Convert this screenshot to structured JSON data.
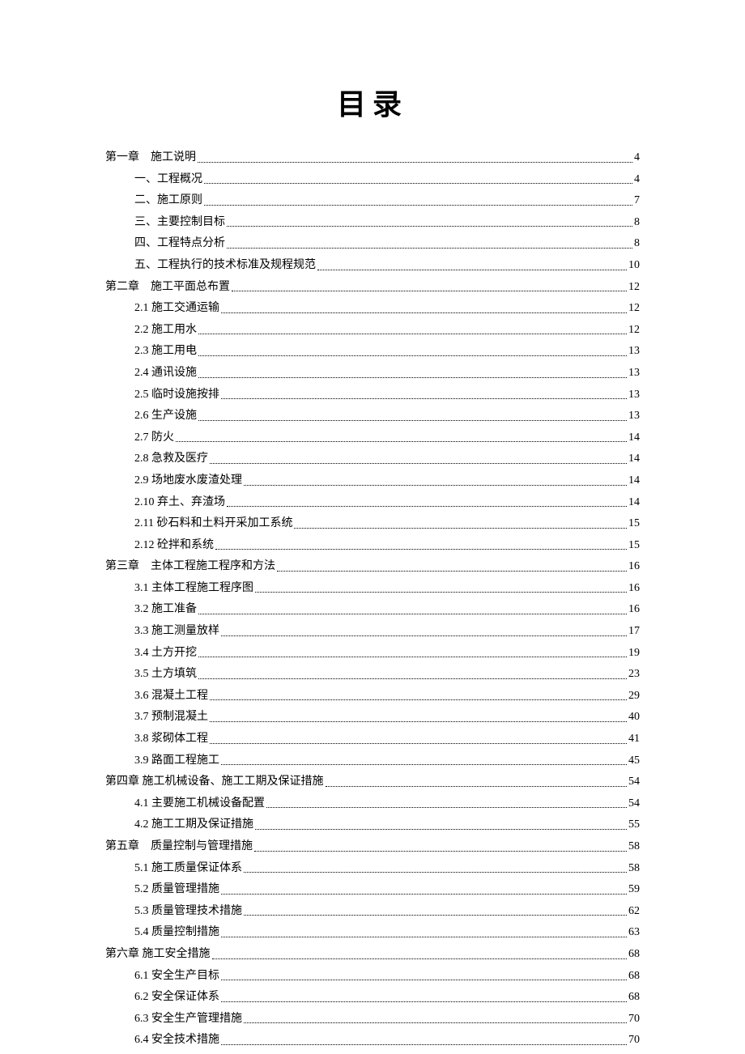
{
  "title": "目录",
  "toc": [
    {
      "level": 0,
      "label": "第一章　施工说明",
      "page": "4"
    },
    {
      "level": 1,
      "label": "一、工程概况",
      "page": "4"
    },
    {
      "level": 1,
      "label": "二、施工原则",
      "page": "7"
    },
    {
      "level": 1,
      "label": "三、主要控制目标",
      "page": "8"
    },
    {
      "level": 1,
      "label": "四、工程特点分析",
      "page": "8"
    },
    {
      "level": 1,
      "label": "五、工程执行的技术标准及规程规范",
      "page": "10"
    },
    {
      "level": 0,
      "label": "第二章　施工平面总布置",
      "page": "12"
    },
    {
      "level": 1,
      "label": "2.1 施工交通运输",
      "page": "12"
    },
    {
      "level": 1,
      "label": "2.2 施工用水",
      "page": "12"
    },
    {
      "level": 1,
      "label": "2.3 施工用电",
      "page": "13"
    },
    {
      "level": 1,
      "label": "2.4 通讯设施",
      "page": "13"
    },
    {
      "level": 1,
      "label": "2.5 临时设施按排",
      "page": "13"
    },
    {
      "level": 1,
      "label": "2.6 生产设施",
      "page": "13"
    },
    {
      "level": 1,
      "label": "2.7 防火",
      "page": "14"
    },
    {
      "level": 1,
      "label": "2.8 急救及医疗",
      "page": "14"
    },
    {
      "level": 1,
      "label": "2.9 场地废水废渣处理",
      "page": "14"
    },
    {
      "level": 1,
      "label": "2.10 弃土、弃渣场",
      "page": "14"
    },
    {
      "level": 1,
      "label": "2.11 砂石料和土料开采加工系统",
      "page": "15"
    },
    {
      "level": 1,
      "label": "2.12 砼拌和系统",
      "page": "15"
    },
    {
      "level": 0,
      "label": "第三章　主体工程施工程序和方法",
      "page": "16"
    },
    {
      "level": 1,
      "label": "3.1 主体工程施工程序图",
      "page": "16"
    },
    {
      "level": 1,
      "label": "3.2 施工准备",
      "page": "16"
    },
    {
      "level": 1,
      "label": "3.3 施工测量放样",
      "page": "17"
    },
    {
      "level": 1,
      "label": "3.4 土方开挖",
      "page": "19"
    },
    {
      "level": 1,
      "label": "3.5 土方填筑",
      "page": "23"
    },
    {
      "level": 1,
      "label": "3.6 混凝土工程",
      "page": "29"
    },
    {
      "level": 1,
      "label": "3.7 预制混凝土",
      "page": "40"
    },
    {
      "level": 1,
      "label": "3.8 浆砌体工程",
      "page": "41"
    },
    {
      "level": 1,
      "label": "3.9 路面工程施工",
      "page": "45"
    },
    {
      "level": 0,
      "label": "第四章 施工机械设备、施工工期及保证措施",
      "page": "54"
    },
    {
      "level": 1,
      "label": "4.1 主要施工机械设备配置",
      "page": "54"
    },
    {
      "level": 1,
      "label": "4.2 施工工期及保证措施",
      "page": "55"
    },
    {
      "level": 0,
      "label": "第五章　质量控制与管理措施",
      "page": "58"
    },
    {
      "level": 1,
      "label": "5.1 施工质量保证体系",
      "page": "58"
    },
    {
      "level": 1,
      "label": "5.2 质量管理措施",
      "page": "59"
    },
    {
      "level": 1,
      "label": "5.3 质量管理技术措施",
      "page": "62"
    },
    {
      "level": 1,
      "label": "5.4 质量控制措施",
      "page": "63"
    },
    {
      "level": 0,
      "label": "第六章  施工安全措施",
      "page": "68"
    },
    {
      "level": 1,
      "label": "6.1 安全生产目标",
      "page": "68"
    },
    {
      "level": 1,
      "label": "6.2 安全保证体系",
      "page": "68"
    },
    {
      "level": 1,
      "label": "6.3 安全生产管理措施",
      "page": "70"
    },
    {
      "level": 1,
      "label": "6.4 安全技术措施",
      "page": "70"
    }
  ]
}
